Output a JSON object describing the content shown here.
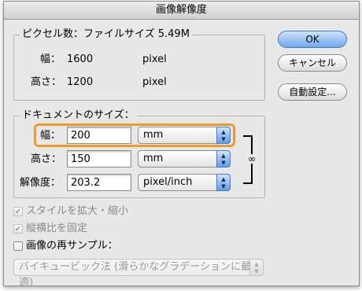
{
  "window": {
    "title": "画像解像度"
  },
  "pixel_dimensions": {
    "header": "ピクセル数：ファイルサイズ 5.49M",
    "width_label": "幅：",
    "width_value": "1600",
    "width_unit": "pixel",
    "height_label": "高さ：",
    "height_value": "1200",
    "height_unit": "pixel"
  },
  "document_size": {
    "header": "ドキュメントのサイズ：",
    "width_label": "幅：",
    "width_value": "200",
    "width_unit": "mm",
    "height_label": "高さ：",
    "height_value": "150",
    "height_unit": "mm",
    "resolution_label": "解像度：",
    "resolution_value": "203.2",
    "resolution_unit": "pixel/inch"
  },
  "buttons": {
    "ok": "OK",
    "cancel": "キャンセル",
    "auto": "自動設定..."
  },
  "options": {
    "scale_styles": {
      "label": "スタイルを拡大・縮小",
      "checked": true,
      "enabled": false
    },
    "constrain": {
      "label": "縦横比を固定",
      "checked": true,
      "enabled": false
    },
    "resample": {
      "label": "画像の再サンプル：",
      "checked": false,
      "enabled": true
    },
    "resample_method": "バイキュービック法 (滑らかなグラデーションに最適)"
  },
  "colors": {
    "focus": "#f19a2b",
    "default_button": "#6fa7ee"
  }
}
